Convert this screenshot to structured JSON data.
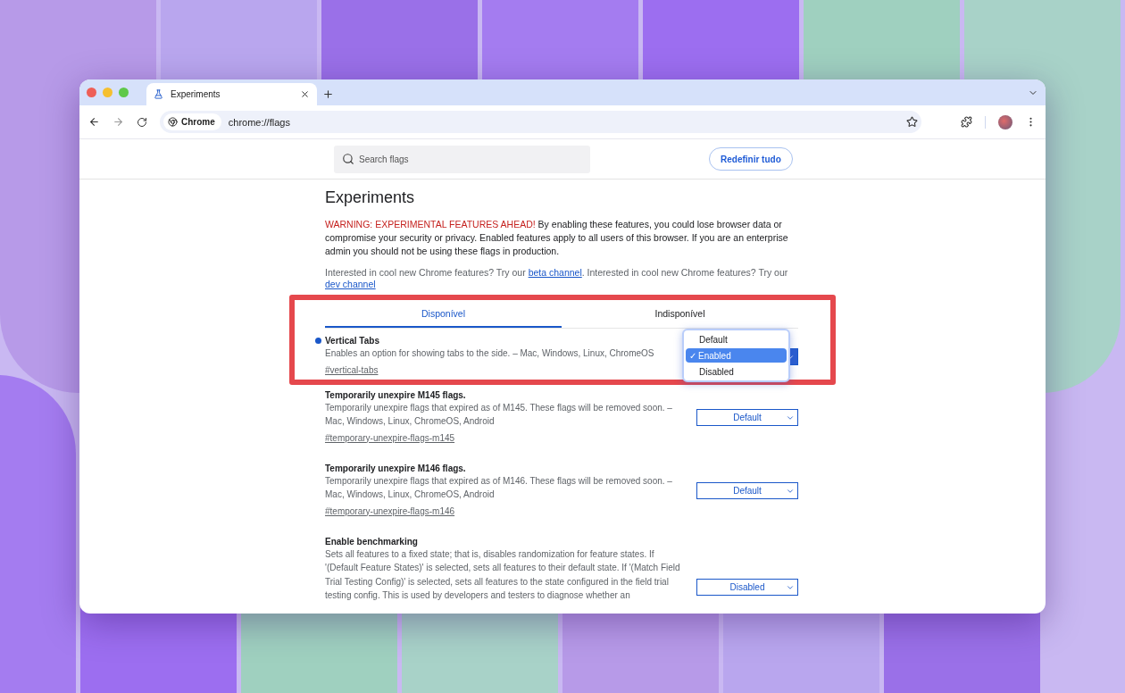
{
  "tab": {
    "title": "Experiments"
  },
  "address_bar": {
    "chip": "Chrome",
    "url": "chrome://flags"
  },
  "search": {
    "placeholder": "Search flags"
  },
  "reset_button": "Redefinir tudo",
  "heading": "Experiments",
  "warning": {
    "lead": "WARNING: EXPERIMENTAL FEATURES AHEAD!",
    "text": " By enabling these features, you could lose browser data or compromise your security or privacy. Enabled features apply to all users of this browser. If you are an enterprise admin you should not be using these flags in production."
  },
  "channels_text": [
    {
      "kind": "text",
      "text": "Interested in cool new Chrome features? Try our "
    },
    {
      "kind": "link",
      "text": "beta channel"
    },
    {
      "kind": "text",
      "text": ". Interested in cool new Chrome features? Try our "
    },
    {
      "kind": "link",
      "text": "dev channel"
    }
  ],
  "highlight_frame": true,
  "tabs": [
    {
      "label": "Disponível",
      "selected": true
    },
    {
      "label": "Indisponível",
      "selected": false
    }
  ],
  "flags": [
    {
      "name": "Vertical Tabs",
      "modified": true,
      "description": "Enables an option for showing tabs to the side. – Mac, Windows, Linux, ChromeOS",
      "link": "#vertical-tabs",
      "menu_open": true,
      "options": [
        {
          "label": "Default",
          "selected": false
        },
        {
          "label": "Enabled",
          "selected": true,
          "check": "✓"
        },
        {
          "label": "Disabled",
          "selected": false
        }
      ]
    },
    {
      "name": "Temporarily unexpire M145 flags.",
      "modified": false,
      "description": "Temporarily unexpire flags that expired as of M145. These flags will be removed soon. – Mac, Windows, Linux, ChromeOS, Android",
      "link": "#temporary-unexpire-flags-m145",
      "value": "Default"
    },
    {
      "name": "Temporarily unexpire M146 flags.",
      "modified": false,
      "description": "Temporarily unexpire flags that expired as of M146. These flags will be removed soon. – Mac, Windows, Linux, ChromeOS, Android",
      "link": "#temporary-unexpire-flags-m146",
      "value": "Default"
    },
    {
      "name": "Enable benchmarking",
      "modified": false,
      "description": "Sets all features to a fixed state; that is, disables randomization for feature states. If '(Default Feature States)' is selected, sets all features to their default state. If '(Match Field Trial Testing Config)' is selected, sets all features to the state configured in the field trial testing config. This is used by developers and testers to diagnose whether an",
      "value": "Disabled"
    }
  ]
}
